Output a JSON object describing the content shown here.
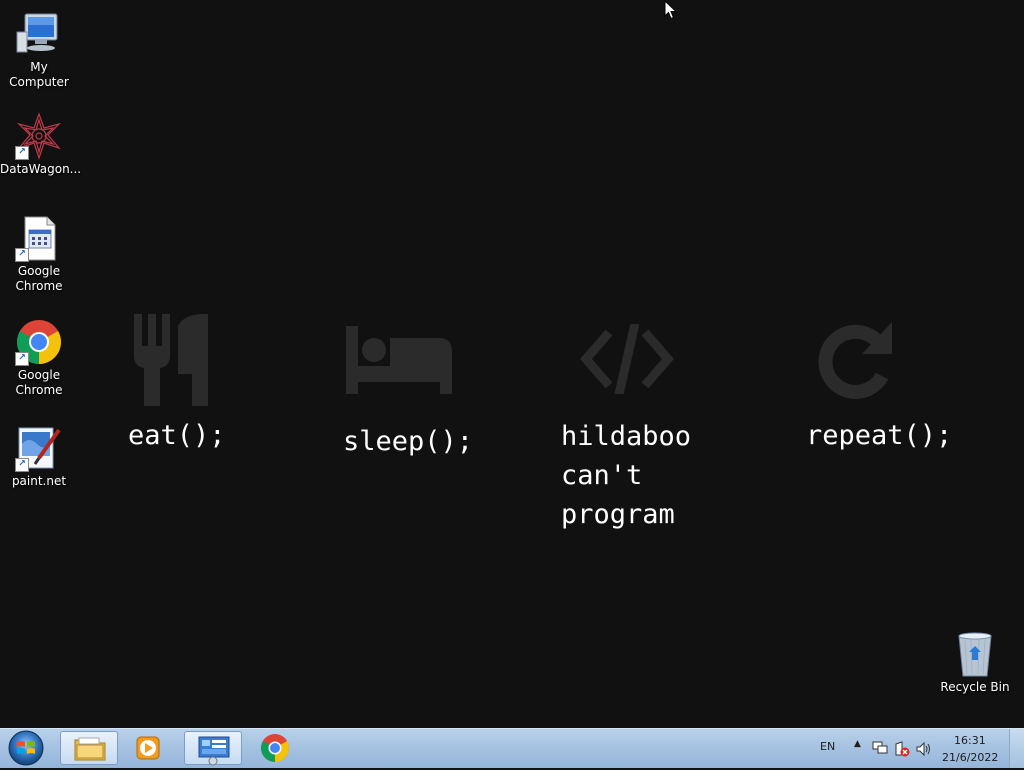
{
  "desktop_icons": [
    {
      "label": "My Computer",
      "icon": "computer-icon"
    },
    {
      "label": "DataWagon...",
      "icon": "datawagon-icon"
    },
    {
      "label": "Google\nChrome",
      "icon": "document-shortcut-icon"
    },
    {
      "label": "Google\nChrome",
      "icon": "chrome-icon"
    },
    {
      "label": "paint.net",
      "icon": "paintnet-icon"
    },
    {
      "label": "Recycle Bin",
      "icon": "recycle-bin-icon"
    }
  ],
  "wallpaper": {
    "items": [
      {
        "icon": "fork-knife-icon",
        "text": "eat();"
      },
      {
        "icon": "bed-icon",
        "text": "sleep();"
      },
      {
        "icon": "code-icon",
        "text": "hildaboo\ncan't\nprogram"
      },
      {
        "icon": "repeat-icon",
        "text": "repeat();"
      }
    ]
  },
  "taskbar": {
    "start_icon": "windows-start-icon",
    "pinned": [
      {
        "name": "windows-explorer",
        "icon": "folder-icon",
        "active": true
      },
      {
        "name": "media-player",
        "icon": "media-player-icon",
        "active": false
      },
      {
        "name": "control-panel",
        "icon": "control-panel-icon",
        "active": true
      },
      {
        "name": "chrome",
        "icon": "chrome-icon",
        "active": false
      }
    ],
    "tray": {
      "language": "EN",
      "time": "16:31",
      "date": "21/6/2022",
      "icons": [
        "show-hidden-icon",
        "network-icon",
        "action-center-icon",
        "volume-icon"
      ]
    }
  },
  "colors": {
    "desktop_bg": "#111111",
    "wallpaper_icon": "#2a2a2a",
    "taskbar_top": "#b9d1ea",
    "taskbar_bottom": "#94b5da"
  }
}
